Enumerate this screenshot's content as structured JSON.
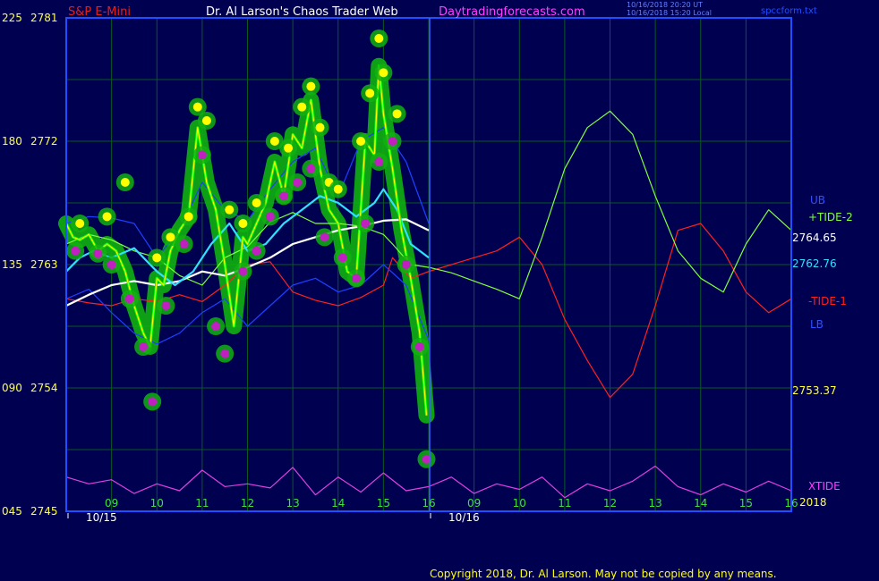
{
  "header": {
    "symbol": "S&P E-Mini",
    "title": "Dr. Al Larson's Chaos Trader Web",
    "site": "Daytradingforecasts.com",
    "updated_ut": "10/16/2018 20:20 UT",
    "updated_local": "10/16/2018 15:20 Local",
    "file": "spccform.txt",
    "copyright": "Copyright 2018, Dr. Al Larson. May not be copied by any means."
  },
  "colors": {
    "background": "#000050",
    "grid": "#0a5a20",
    "frame": "#1e50ff",
    "price": "#00ff00",
    "tide2": "#80ff40",
    "tide1": "#ff2020",
    "xtide": "#e040e0",
    "upper_band": "#1e40ff",
    "cyan": "#30e0ff",
    "white": "#ffffff",
    "yellow": "#ffff00",
    "dots_high": "#ffff00",
    "dots_low": "#c020c0",
    "halo": "#10b010"
  },
  "chart_data": {
    "type": "line",
    "title": "S&P E-Mini",
    "ylim": [
      2745,
      2781
    ],
    "y_ticks": [
      {
        "left": "225",
        "right": "2781",
        "value": 2781
      },
      {
        "left": "180",
        "right": "2772",
        "value": 2772
      },
      {
        "left": "135",
        "right": "2763",
        "value": 2763
      },
      {
        "left": "090",
        "right": "2754",
        "value": 2754
      },
      {
        "left": "045",
        "right": "2745",
        "value": 2745
      }
    ],
    "x_hours": [
      "09",
      "10",
      "11",
      "12",
      "13",
      "14",
      "15",
      "16",
      "09",
      "10",
      "11",
      "12",
      "13",
      "14",
      "15",
      "16"
    ],
    "x_dates": [
      {
        "label": "10/15",
        "slot": 0
      },
      {
        "label": "10/16",
        "slot": 8
      }
    ],
    "year_label": "2018",
    "right_labels": {
      "ub": "UB",
      "tide2": "+TIDE-2",
      "ub_value": "2764.65",
      "mid_value": "2762.76",
      "tide1": "-TIDE-1",
      "lb": "LB",
      "low_value": "2753.37",
      "xtide": "XTIDE"
    },
    "series": [
      {
        "key": "tide2",
        "name": "+TIDE-2",
        "x": [
          0,
          0.5,
          1,
          1.5,
          2,
          2.5,
          3,
          3.5,
          4,
          4.5,
          5,
          5.5,
          6,
          6.5,
          7,
          7.2,
          7.6,
          8,
          8.5,
          9,
          9.5,
          10,
          10.5,
          11,
          11.5,
          12,
          12.5,
          13,
          13.5,
          14,
          14.5,
          15,
          15.5,
          16
        ],
        "y": [
          2764.5,
          2765.2,
          2764.8,
          2764.0,
          2763.5,
          2762.2,
          2761.5,
          2763.5,
          2764.3,
          2766.1,
          2766.8,
          2766.0,
          2766.0,
          2765.8,
          2765.2,
          2764.5,
          2763.0,
          2762.8,
          2762.4,
          2761.8,
          2761.2,
          2760.5,
          2765,
          2770,
          2773.0,
          2774.2,
          2772.5,
          2768,
          2764.0,
          2762.0,
          2761.0,
          2764.5,
          2767.0,
          2765.5
        ]
      },
      {
        "key": "tide1",
        "name": "-TIDE-1",
        "x": [
          0,
          0.5,
          1,
          1.5,
          2,
          2.5,
          3,
          3.5,
          4,
          4.5,
          5,
          5.5,
          6,
          6.5,
          7,
          7.2,
          7.6,
          8,
          8.5,
          9,
          9.5,
          10,
          10.5,
          11,
          11.5,
          12,
          12.5,
          13,
          13.5,
          14,
          14.5,
          15,
          15.5,
          16
        ],
        "y": [
          2760.5,
          2760.2,
          2760.0,
          2760.5,
          2760.3,
          2760.8,
          2760.3,
          2761.5,
          2763.0,
          2763.2,
          2761.0,
          2760.4,
          2760.0,
          2760.6,
          2761.5,
          2763.5,
          2762.0,
          2762.5,
          2763.0,
          2763.5,
          2764.0,
          2765.0,
          2763.0,
          2759,
          2756.0,
          2753.3,
          2755.0,
          2760.0,
          2765.5,
          2766.0,
          2764.0,
          2761.0,
          2759.5,
          2760.5
        ]
      },
      {
        "key": "upper_band",
        "name": "UB",
        "x": [
          0,
          0.5,
          1,
          1.5,
          2,
          2.5,
          3,
          3.5,
          4,
          4.5,
          5,
          5.5,
          6,
          6.5,
          7,
          7.5,
          8
        ],
        "y": [
          2766.0,
          2766.5,
          2766.4,
          2766.0,
          2763.5,
          2765.5,
          2769.0,
          2767.0,
          2766.2,
          2768.5,
          2770.5,
          2771.5,
          2768.0,
          2772.0,
          2773.0,
          2770.5,
          2766.0
        ]
      },
      {
        "key": "lower_band",
        "name": "LB",
        "x": [
          0,
          0.5,
          1,
          1.5,
          2,
          2.5,
          3,
          3.5,
          4,
          4.5,
          5,
          5.5,
          6,
          6.5,
          7,
          7.5,
          8
        ],
        "y": [
          2760.5,
          2761.2,
          2759.5,
          2758.0,
          2757.2,
          2758.0,
          2759.5,
          2760.5,
          2758.5,
          2760.0,
          2761.5,
          2762.0,
          2761.0,
          2761.5,
          2763.0,
          2761.5,
          2757.5
        ]
      },
      {
        "key": "cyan",
        "name": "",
        "x": [
          0,
          0.3,
          0.6,
          1,
          1.5,
          2,
          2.4,
          2.8,
          3.2,
          3.6,
          4,
          4.4,
          4.8,
          5.2,
          5.6,
          6,
          6.4,
          6.8,
          7,
          7.3,
          7.6,
          8
        ],
        "y": [
          2762.5,
          2763.5,
          2764.0,
          2763.5,
          2764.2,
          2762.5,
          2761.5,
          2762.5,
          2764.5,
          2766.0,
          2764.0,
          2764.5,
          2766.0,
          2767.0,
          2768.0,
          2767.5,
          2766.5,
          2767.5,
          2768.5,
          2767.0,
          2764.5,
          2763.5
        ]
      },
      {
        "key": "white",
        "name": "",
        "x": [
          0,
          0.5,
          1,
          1.5,
          2,
          2.5,
          3,
          3.5,
          4,
          4.5,
          5,
          5.5,
          6,
          6.5,
          7,
          7.5,
          8
        ],
        "y": [
          2760.0,
          2760.8,
          2761.5,
          2761.8,
          2761.5,
          2761.8,
          2762.5,
          2762.2,
          2762.8,
          2763.5,
          2764.5,
          2765.0,
          2765.5,
          2765.8,
          2766.2,
          2766.3,
          2765.5
        ]
      },
      {
        "key": "price",
        "name": "",
        "x": [
          0,
          0.15,
          0.3,
          0.5,
          0.7,
          0.9,
          1.1,
          1.3,
          1.5,
          1.7,
          1.85,
          2.0,
          2.15,
          2.3,
          2.5,
          2.7,
          2.9,
          3.1,
          3.3,
          3.5,
          3.7,
          3.9,
          4.0,
          4.2,
          4.4,
          4.6,
          4.8,
          5.0,
          5.2,
          5.4,
          5.6,
          5.8,
          6.0,
          6.2,
          6.4,
          6.6,
          6.8,
          6.9,
          7.0,
          7.2,
          7.4,
          7.6,
          7.8,
          7.95
        ],
        "y": [
          2766.0,
          2765.0,
          2764.8,
          2765.2,
          2764.0,
          2764.5,
          2764.0,
          2762.5,
          2760.0,
          2758.0,
          2757.0,
          2762.0,
          2761.5,
          2764.0,
          2765.5,
          2766.5,
          2773.0,
          2769.0,
          2767.0,
          2763.0,
          2758.5,
          2765.0,
          2764.5,
          2766.0,
          2767.5,
          2770.5,
          2768.0,
          2772.5,
          2771.5,
          2775.0,
          2770.0,
          2767.0,
          2766.0,
          2762.5,
          2762.0,
          2772.0,
          2771.0,
          2777.5,
          2774.0,
          2770.0,
          2765.5,
          2762.0,
          2758.0,
          2752.0
        ]
      },
      {
        "key": "xtide",
        "name": "XTIDE",
        "x": [
          0,
          0.5,
          1,
          1.5,
          2,
          2.5,
          3,
          3.5,
          4,
          4.5,
          5,
          5.5,
          6,
          6.5,
          7,
          7.5,
          8,
          8.5,
          9,
          9.5,
          10,
          10.5,
          11,
          11.5,
          12,
          12.5,
          13,
          13.5,
          14,
          14.5,
          15,
          15.5,
          16
        ],
        "y": [
          2747.5,
          2747.0,
          2747.3,
          2746.3,
          2747.0,
          2746.5,
          2748.0,
          2746.8,
          2747.0,
          2746.7,
          2748.2,
          2746.2,
          2747.5,
          2746.4,
          2747.8,
          2746.5,
          2746.8,
          2747.5,
          2746.3,
          2747.0,
          2746.6,
          2747.5,
          2746.0,
          2747.0,
          2746.5,
          2747.2,
          2748.3,
          2746.8,
          2746.2,
          2747.0,
          2746.4,
          2747.2,
          2746.5
        ]
      }
    ],
    "highs": {
      "x": [
        0.3,
        0.9,
        1.3,
        2.0,
        2.3,
        2.7,
        2.9,
        3.1,
        3.6,
        3.9,
        4.2,
        4.6,
        4.9,
        5.2,
        5.4,
        5.6,
        5.8,
        6.0,
        6.5,
        6.7,
        6.9,
        7.0,
        7.3
      ],
      "y": [
        2766.0,
        2766.5,
        2769.0,
        2763.5,
        2765.0,
        2766.5,
        2774.5,
        2773.5,
        2767.0,
        2766.0,
        2767.5,
        2772.0,
        2771.5,
        2774.5,
        2776.0,
        2773.0,
        2769.0,
        2768.5,
        2772.0,
        2775.5,
        2779.5,
        2777.0,
        2774.0
      ]
    },
    "lows": {
      "x": [
        0.2,
        0.7,
        1.0,
        1.4,
        1.7,
        1.9,
        2.2,
        2.6,
        3.0,
        3.3,
        3.5,
        3.9,
        4.2,
        4.5,
        4.8,
        5.1,
        5.4,
        5.7,
        6.1,
        6.4,
        6.6,
        6.9,
        7.2,
        7.5,
        7.8,
        7.95
      ],
      "y": [
        2764.0,
        2763.8,
        2763.0,
        2760.5,
        2757.0,
        2753.0,
        2760.0,
        2764.5,
        2771.0,
        2758.5,
        2756.5,
        2762.5,
        2764.0,
        2766.5,
        2768.0,
        2769.0,
        2770.0,
        2765.0,
        2763.5,
        2762.0,
        2766.0,
        2770.5,
        2772.0,
        2763.0,
        2757.0,
        2748.8
      ]
    }
  }
}
